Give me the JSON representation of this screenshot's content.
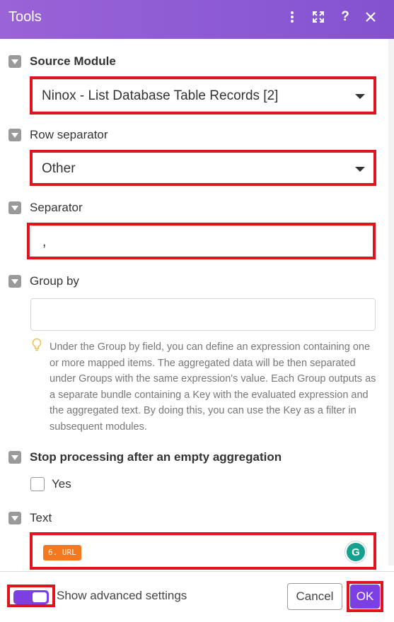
{
  "header": {
    "title": "Tools",
    "icons": [
      "more-vertical-icon",
      "expand-icon",
      "help-icon",
      "close-icon"
    ]
  },
  "sections": {
    "source_module": {
      "label": "Source Module",
      "value": "Ninox - List Database Table Records [2]"
    },
    "row_separator": {
      "label": "Row separator",
      "value": "Other"
    },
    "separator": {
      "label": "Separator",
      "value": ","
    },
    "group_by": {
      "label": "Group by",
      "value": "",
      "hint": "Under the Group by field, you can define an expression containing one or more mapped items. The aggregated data will be then separated under Groups with the same expression's value. Each Group outputs as a separate bundle containing a Key with the evaluated expression and the aggregated text. By doing this, you can use the Key as a filter in subsequent modules."
    },
    "stop_processing": {
      "label": "Stop processing after an empty aggregation",
      "option_label": "Yes",
      "checked": false
    },
    "text": {
      "label": "Text",
      "token": "6. URL",
      "token_color": "#f47820"
    }
  },
  "footer": {
    "advanced_label": "Show advanced settings",
    "advanced_enabled": true,
    "cancel_label": "Cancel",
    "ok_label": "OK"
  },
  "colors": {
    "header_gradient_start": "#9a63d6",
    "header_gradient_end": "#8452cf",
    "accent": "#7b3fe4",
    "highlight": "#e0141e",
    "grammarly": "#15a18d"
  }
}
